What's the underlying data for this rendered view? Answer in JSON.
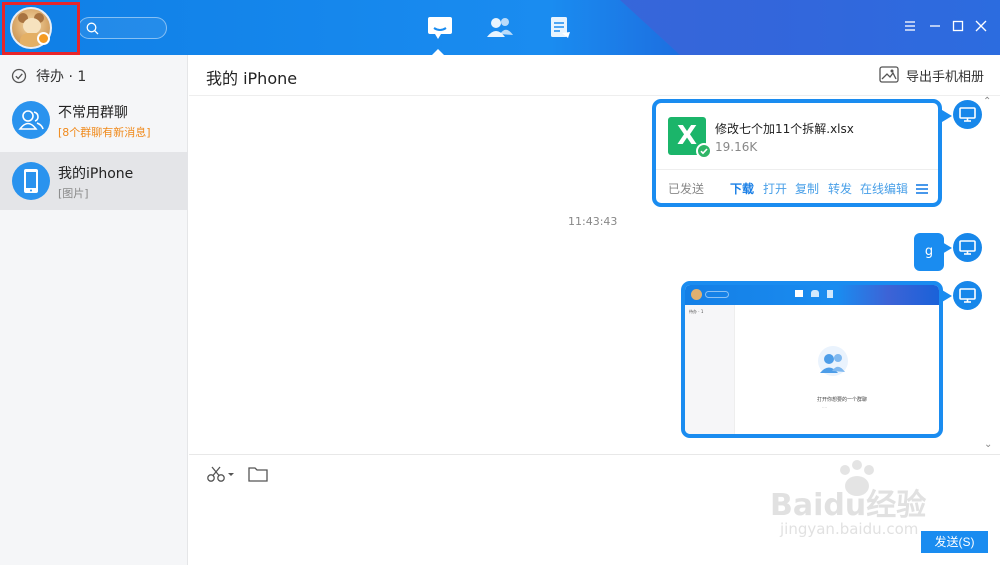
{
  "sidebar": {
    "todo_label": "待办 · 1",
    "conversations": [
      {
        "name": "不常用群聊",
        "subtitle": "[8个群聊有新消息]"
      },
      {
        "name": "我的iPhone",
        "subtitle": "[图片]"
      }
    ]
  },
  "chat": {
    "title": "我的 iPhone",
    "export_label": "导出手机相册",
    "file_message": {
      "file_name": "修改七个加11个拆解.xlsx",
      "file_size": "19.16K",
      "status": "已发送",
      "actions": [
        "下载",
        "打开",
        "复制",
        "转发",
        "在线编辑"
      ]
    },
    "timestamp": "11:43:43",
    "text_message": "g",
    "screenshot_preview": {
      "todo_label": "待办 · 1",
      "caption": "打开你想要的一个群聊",
      "sub_caption": "...."
    }
  },
  "input": {
    "send_label": "发送(S)"
  },
  "watermark": {
    "brand": "Baidu经验",
    "url": "jingyan.baidu.com"
  },
  "colors": {
    "brand_blue": "#1a8cf0",
    "highlight_red": "#e8252a",
    "excel_green": "#1bb56a",
    "unread_orange": "#f08a1c"
  }
}
